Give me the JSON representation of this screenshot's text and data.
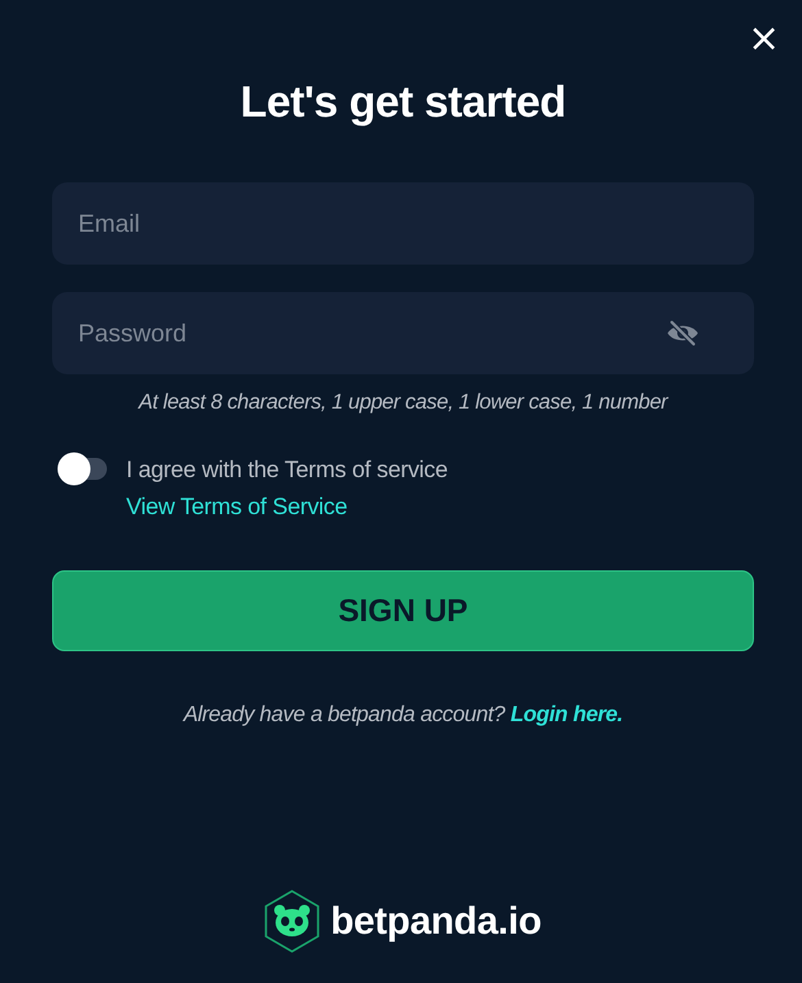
{
  "dialog": {
    "title": "Let's get started",
    "close": "×"
  },
  "fields": [
    {
      "kind": "email",
      "placeholder": "Email"
    },
    {
      "kind": "password",
      "placeholder": "Password"
    }
  ],
  "password_hint": "At least 8 characters, 1 upper case, 1 lower case, 1 number",
  "terms": {
    "on": false,
    "text": "I agree with the Terms of service",
    "link": "View Terms of Service"
  },
  "submit": "SIGN UP",
  "login": {
    "text": "Already have a betpanda account?",
    "link": "Login here."
  },
  "brand": "betpanda.io"
}
